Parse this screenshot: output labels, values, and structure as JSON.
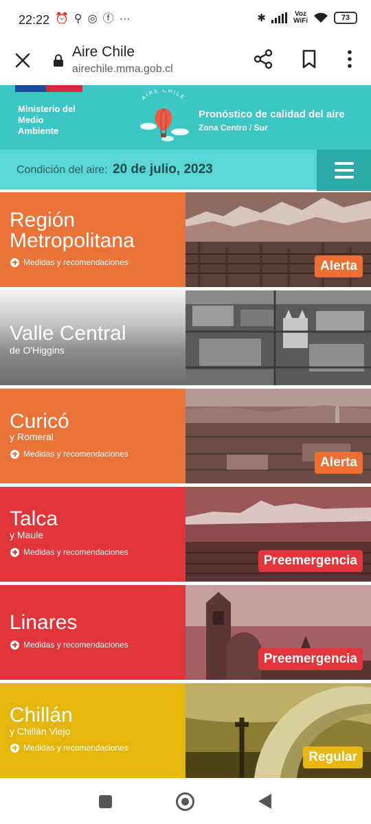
{
  "status_bar": {
    "time": "22:22",
    "icons_left": [
      "alarm-icon",
      "keyhole-icon",
      "chrome-icon",
      "facebook-icon",
      "more-dots-icon"
    ],
    "volte_line1": "Voz",
    "volte_line2": "WiFi",
    "battery": "73"
  },
  "browser": {
    "title": "Aire Chile",
    "url": "airechile.mma.gob.cl"
  },
  "site_header": {
    "ministry_line1": "Ministerio del",
    "ministry_line2": "Medio",
    "ministry_line3": "Ambiente",
    "logo_text": "AIRE CHILE",
    "forecast_title": "Pronóstico de calidad del aire",
    "forecast_subtitle": "Zona Centro / Sur"
  },
  "condition": {
    "label": "Condición del aire:",
    "date": "20 de julio, 2023"
  },
  "regions": [
    {
      "name_line1": "Región",
      "name_line2": "Metropolitana",
      "subtitle": "",
      "measures": "Medidas y recomendaciones",
      "status": "Alerta",
      "color": "#ea733a",
      "badge_color": "#ee6f33",
      "photo": "mountains-city"
    },
    {
      "name_line1": "Valle Central",
      "name_line2": "",
      "subtitle": "de O'Higgins",
      "measures": "",
      "status": "",
      "color": "#8a8a8a",
      "badge_color": "",
      "photo": "town-church"
    },
    {
      "name_line1": "Curicó",
      "name_line2": "",
      "subtitle": "y Romeral",
      "measures": "Medidas y recomendaciones",
      "status": "Alerta",
      "color": "#ea733a",
      "badge_color": "#ee6f33",
      "photo": "city-valley"
    },
    {
      "name_line1": "Talca",
      "name_line2": "",
      "subtitle": "y Maule",
      "measures": "Medidas y recomendaciones",
      "status": "Preemergencia",
      "color": "#e0353a",
      "badge_color": "#e3363c",
      "photo": "volcano-city"
    },
    {
      "name_line1": "Linares",
      "name_line2": "",
      "subtitle": "",
      "measures": "Medidas y recomendaciones",
      "status": "Preemergencia",
      "color": "#e0353a",
      "badge_color": "#e3363c",
      "photo": "cathedral-tower"
    },
    {
      "name_line1": "Chillán",
      "name_line2": "",
      "subtitle": "y Chillán Viejo",
      "measures": "Medidas y recomendaciones",
      "status": "Regular",
      "color": "#e5b60e",
      "badge_color": "#e8b711",
      "photo": "arch-cross"
    }
  ]
}
